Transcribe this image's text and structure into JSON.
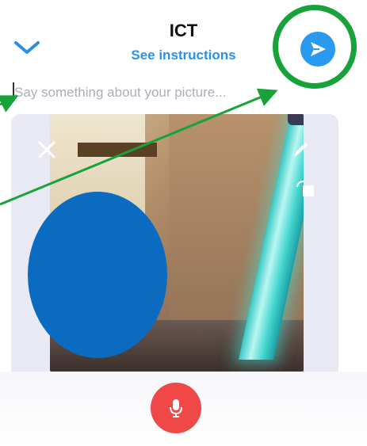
{
  "header": {
    "title": "ICT",
    "instructions_link": "See instructions"
  },
  "caption": {
    "placeholder": "Say something about your picture..."
  },
  "colors": {
    "accent": "#2a9af0",
    "link": "#2f8fe0",
    "record": "#f04747",
    "annotation": "#18a33a",
    "redaction": "#0a6bc1"
  },
  "icons": {
    "back": "chevron-down-icon",
    "send": "send-icon",
    "close": "close-icon",
    "edit": "pencil-icon",
    "crop": "crop-icon",
    "record": "microphone-icon"
  }
}
